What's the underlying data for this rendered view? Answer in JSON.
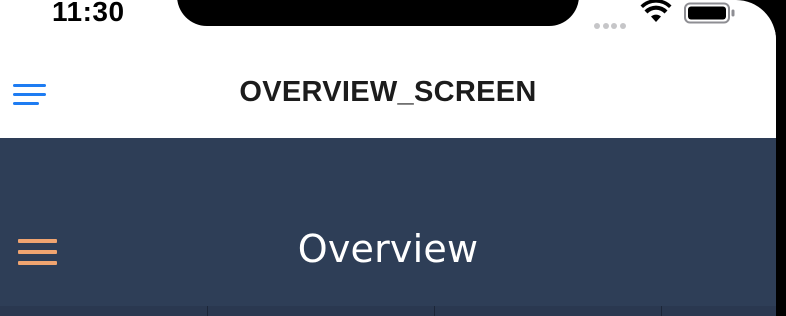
{
  "status_bar": {
    "time": "11:30"
  },
  "nav_bar": {
    "title": "OVERVIEW_SCREEN",
    "menu_icon": "hamburger-menu-icon",
    "accent_color": "#1e7cf2"
  },
  "content": {
    "title": "Overview",
    "menu_icon": "hamburger-menu-icon",
    "background_color": "#2e3e57",
    "accent_color": "#f0a470",
    "tab_count": 4
  }
}
